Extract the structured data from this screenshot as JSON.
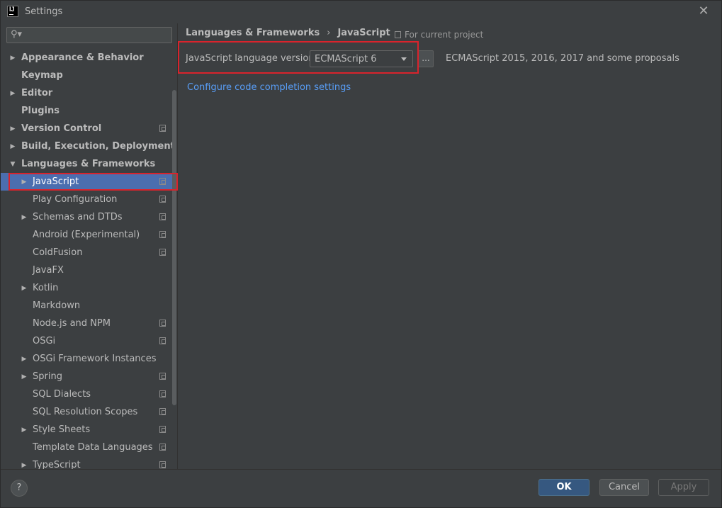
{
  "window": {
    "title": "Settings",
    "logo_text": "IJ"
  },
  "search": {
    "placeholder": "",
    "value": ""
  },
  "sidebar": {
    "items": [
      {
        "label": "Appearance & Behavior",
        "expandable": true,
        "level": 0
      },
      {
        "label": "Keymap",
        "expandable": false,
        "level": 0
      },
      {
        "label": "Editor",
        "expandable": true,
        "level": 0
      },
      {
        "label": "Plugins",
        "expandable": false,
        "level": 0
      },
      {
        "label": "Version Control",
        "expandable": true,
        "level": 0,
        "project": true
      },
      {
        "label": "Build, Execution, Deployment",
        "expandable": true,
        "level": 0
      },
      {
        "label": "Languages & Frameworks",
        "expandable": true,
        "expanded": true,
        "level": 0
      },
      {
        "label": "JavaScript",
        "expandable": true,
        "level": 1,
        "project": true,
        "selected": true
      },
      {
        "label": "Play Configuration",
        "expandable": false,
        "level": 1,
        "project": true
      },
      {
        "label": "Schemas and DTDs",
        "expandable": true,
        "level": 1,
        "project": true
      },
      {
        "label": "Android (Experimental)",
        "expandable": false,
        "level": 1,
        "project": true
      },
      {
        "label": "ColdFusion",
        "expandable": false,
        "level": 1,
        "project": true
      },
      {
        "label": "JavaFX",
        "expandable": false,
        "level": 1
      },
      {
        "label": "Kotlin",
        "expandable": true,
        "level": 1
      },
      {
        "label": "Markdown",
        "expandable": false,
        "level": 1
      },
      {
        "label": "Node.js and NPM",
        "expandable": false,
        "level": 1,
        "project": true
      },
      {
        "label": "OSGi",
        "expandable": false,
        "level": 1,
        "project": true
      },
      {
        "label": "OSGi Framework Instances",
        "expandable": true,
        "level": 1
      },
      {
        "label": "Spring",
        "expandable": true,
        "level": 1,
        "project": true
      },
      {
        "label": "SQL Dialects",
        "expandable": false,
        "level": 1,
        "project": true
      },
      {
        "label": "SQL Resolution Scopes",
        "expandable": false,
        "level": 1,
        "project": true
      },
      {
        "label": "Style Sheets",
        "expandable": true,
        "level": 1,
        "project": true
      },
      {
        "label": "Template Data Languages",
        "expandable": false,
        "level": 1,
        "project": true
      },
      {
        "label": "TypeScript",
        "expandable": true,
        "level": 1,
        "project": true
      }
    ]
  },
  "main": {
    "breadcrumb": [
      "Languages & Frameworks",
      "JavaScript"
    ],
    "breadcrumb_sep": "›",
    "for_project": "For current project",
    "lang_label": "JavaScript language version",
    "lang_value": "ECMAScript 6",
    "dots_label": "...",
    "lang_desc": "ECMAScript 2015, 2016, 2017 and some proposals",
    "config_link": "Configure code completion settings"
  },
  "footer": {
    "help": "?",
    "ok": "OK",
    "cancel": "Cancel",
    "apply": "Apply"
  },
  "colors": {
    "background": "#3c3f41",
    "selection": "#4b6eaf",
    "link": "#589df6",
    "highlight": "#d9232c",
    "ok_button": "#365880"
  }
}
